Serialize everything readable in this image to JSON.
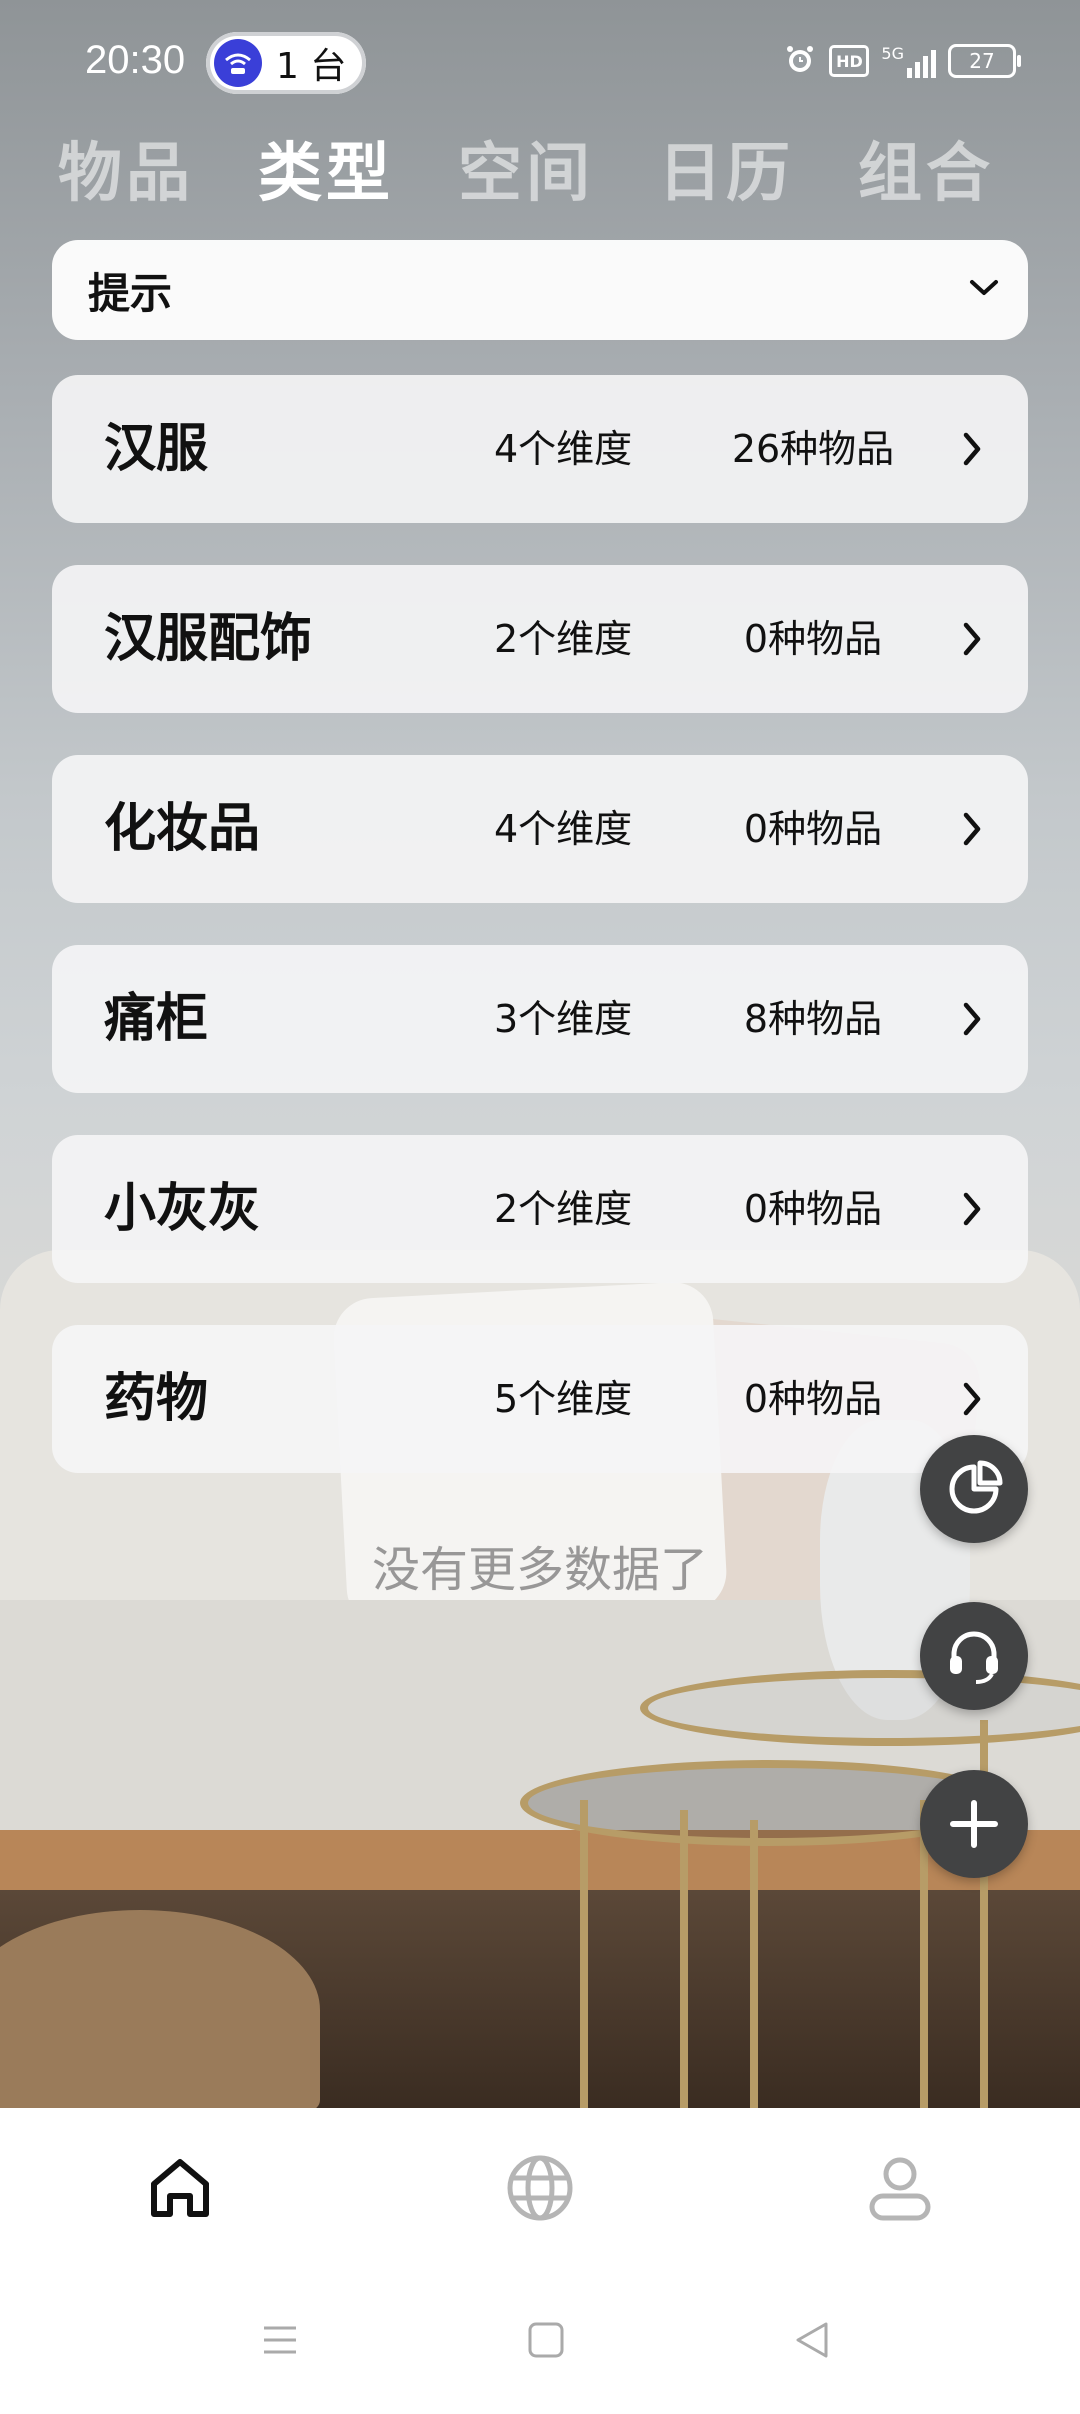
{
  "status_bar": {
    "time": "20:30",
    "device_count": "1 台",
    "hd_label": "HD",
    "network_label": "5G",
    "battery": "27"
  },
  "tabs": [
    {
      "label": "物品",
      "active": false
    },
    {
      "label": "类型",
      "active": true
    },
    {
      "label": "空间",
      "active": false
    },
    {
      "label": "日历",
      "active": false
    },
    {
      "label": "组合",
      "active": false
    }
  ],
  "tips": {
    "label": "提示"
  },
  "categories": [
    {
      "name": "汉服",
      "dimensions": "4个维度",
      "items": "26种物品"
    },
    {
      "name": "汉服配饰",
      "dimensions": "2个维度",
      "items": "0种物品"
    },
    {
      "name": "化妆品",
      "dimensions": "4个维度",
      "items": "0种物品"
    },
    {
      "name": "痛柜",
      "dimensions": "3个维度",
      "items": "8种物品"
    },
    {
      "name": "小灰灰",
      "dimensions": "2个维度",
      "items": "0种物品"
    },
    {
      "name": "药物",
      "dimensions": "5个维度",
      "items": "0种物品"
    }
  ],
  "no_more_text": "没有更多数据了",
  "fabs": [
    "pie-chart-icon",
    "headset-icon",
    "plus-icon"
  ],
  "bottom_nav": [
    "home-icon",
    "globe-icon",
    "user-icon"
  ],
  "colors": {
    "fab_bg": "#424344",
    "active_icon": "#111111",
    "inactive_icon": "#b5b5b5"
  }
}
